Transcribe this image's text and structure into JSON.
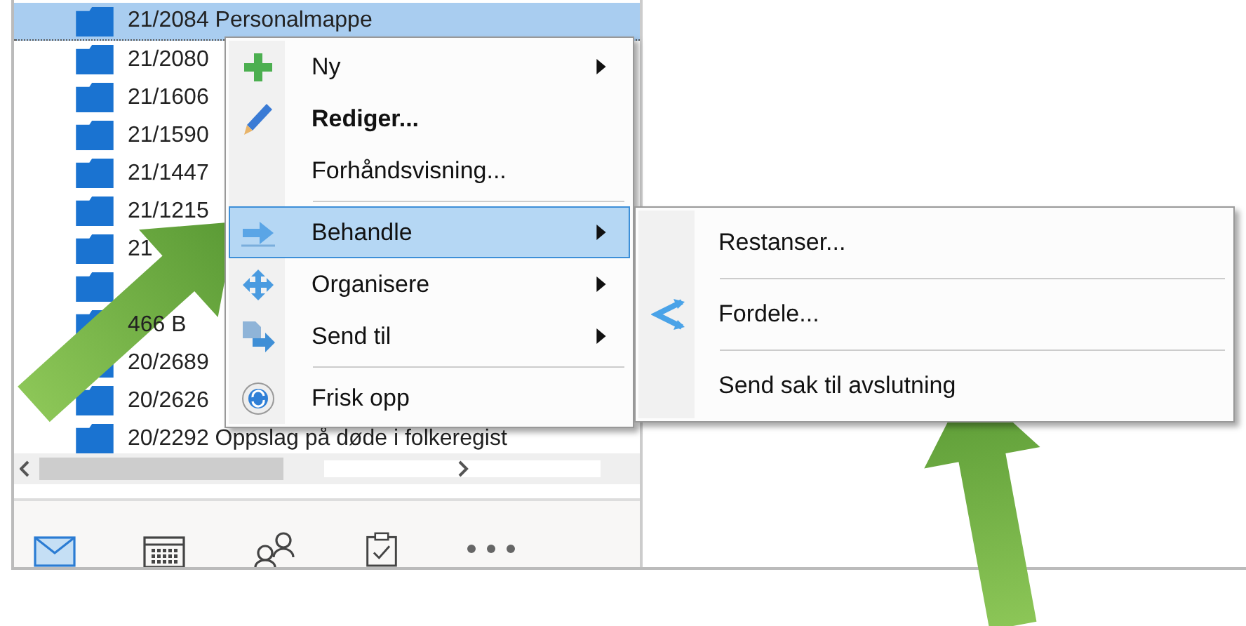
{
  "case_list": {
    "rows": [
      {
        "text": "21/2084 Personalmappe",
        "selected": true
      },
      {
        "text": "21/2080",
        "selected": false
      },
      {
        "text": "21/1606",
        "selected": false
      },
      {
        "text": "21/1590",
        "selected": false
      },
      {
        "text": "21/1447",
        "selected": false
      },
      {
        "text": "21/1215",
        "selected": false
      },
      {
        "text": "21",
        "selected": false
      },
      {
        "selected": false
      },
      {
        "text": "466 B",
        "selected": false
      },
      {
        "text": "20/2689",
        "selected": false
      },
      {
        "text": "20/2626",
        "selected": false
      },
      {
        "text": "20/2292 Oppslag på døde i folkeregist",
        "selected": false
      }
    ]
  },
  "nav": [
    {
      "selected": true
    },
    {
      "selected": false
    },
    {
      "selected": false
    },
    {
      "selected": false
    },
    {
      "selected": false
    }
  ],
  "context_menu": {
    "items": [
      {
        "kind": "item",
        "label": "Ny",
        "bold": false,
        "submenu": true,
        "selected": false
      },
      {
        "kind": "item",
        "label": "Rediger...",
        "bold": true,
        "submenu": false,
        "selected": false
      },
      {
        "kind": "item",
        "label": "Forhåndsvisning...",
        "bold": false,
        "submenu": false,
        "selected": false
      },
      {
        "kind": "separator"
      },
      {
        "kind": "item",
        "label": "Behandle",
        "bold": false,
        "submenu": true,
        "selected": true
      },
      {
        "kind": "item",
        "label": "Organisere",
        "bold": false,
        "submenu": true,
        "selected": false
      },
      {
        "kind": "item",
        "label": "Send til",
        "bold": false,
        "submenu": true,
        "selected": false
      },
      {
        "kind": "separator"
      },
      {
        "kind": "item",
        "label": "Frisk opp",
        "bold": false,
        "submenu": false,
        "selected": false
      }
    ]
  },
  "submenu": {
    "items": [
      {
        "kind": "item",
        "label": "Restanser..."
      },
      {
        "kind": "separator"
      },
      {
        "kind": "item",
        "label": "Fordele..."
      },
      {
        "kind": "separator"
      },
      {
        "kind": "item",
        "label": "Send sak til avslutning"
      }
    ]
  }
}
